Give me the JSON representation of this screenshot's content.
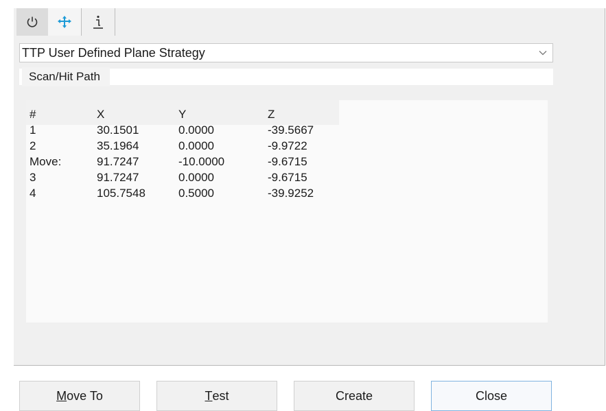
{
  "toolbar": {
    "tabs": [
      {
        "icon": "power-icon"
      },
      {
        "icon": "move-arrows-icon"
      },
      {
        "icon": "info-icon"
      }
    ],
    "accent": "#1e9bd7"
  },
  "strategy": {
    "selected": "TTP User Defined Plane Strategy"
  },
  "section": {
    "label": "Scan/Hit Path"
  },
  "path_table": {
    "headers": [
      "#",
      "X",
      "Y",
      "Z"
    ],
    "rows": [
      [
        "1",
        "30.1501",
        "0.0000",
        "-39.5667"
      ],
      [
        "2",
        "35.1964",
        "0.0000",
        "-9.9722"
      ],
      [
        "Move:",
        "91.7247",
        "-10.0000",
        "-9.6715"
      ],
      [
        "3",
        "91.7247",
        "0.0000",
        "-9.6715"
      ],
      [
        "4",
        "105.7548",
        "0.5000",
        "-39.9252"
      ]
    ]
  },
  "buttons": {
    "move_to": {
      "mnemonic": "M",
      "rest": "ove To"
    },
    "test": {
      "mnemonic": "T",
      "rest": "est"
    },
    "create": "Create",
    "close": "Close"
  }
}
